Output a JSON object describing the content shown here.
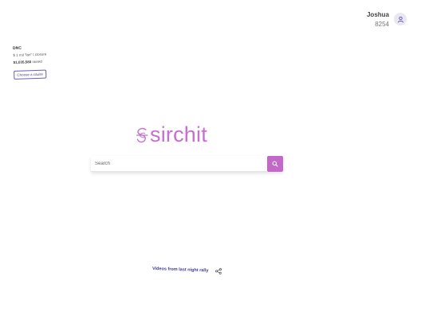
{
  "user": {
    "name": "Joshua",
    "score": "8254",
    "icon": "user-icon"
  },
  "cause": {
    "org": "DNC",
    "subtitle": "$ 1 mil  \"lan\" t closure",
    "raised_amount": "$1,035,580",
    "raised_label": "raised",
    "button_label": "Choose a cause"
  },
  "logo": {
    "text": "sirchit",
    "icon": "sirchit-logo-icon",
    "color": "#c66fd1"
  },
  "search": {
    "placeholder": "Search",
    "button_icon": "search-icon",
    "button_color": "#c368c9"
  },
  "video_link": {
    "label": "Videos from last night rally",
    "icon": "share-icon"
  },
  "colors": {
    "accent": "#c368c9",
    "link": "#3e3a8c",
    "avatar_bg": "#e9e7f3"
  }
}
